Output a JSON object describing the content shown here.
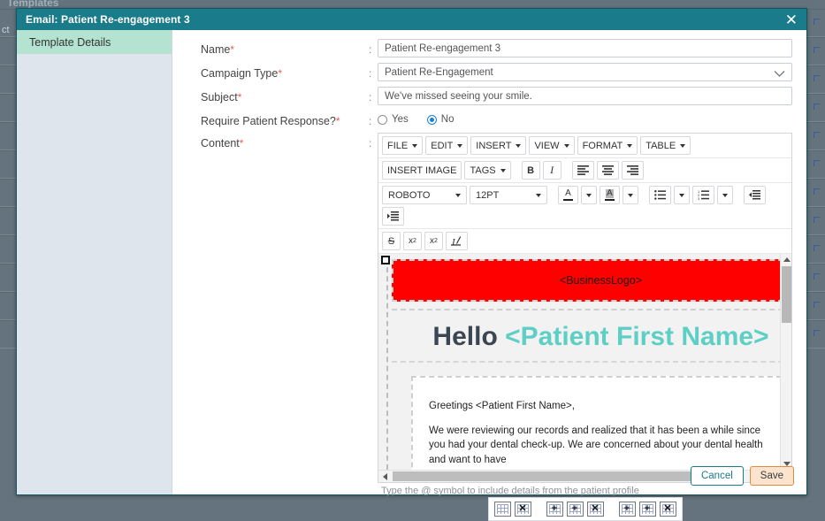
{
  "background": {
    "page_heading": "Templates",
    "column_label": "ct",
    "row_count": 12
  },
  "dialog": {
    "title": "Email: Patient Re-engagement 3",
    "close_icon": "close-icon"
  },
  "sidebar": {
    "items": [
      {
        "label": "Template Details",
        "active": true
      }
    ]
  },
  "form": {
    "colon": ":",
    "required_marker": "*",
    "fields": {
      "name": {
        "label": "Name",
        "value": "Patient Re-engagement 3",
        "required": true
      },
      "campaign_type": {
        "label": "Campaign Type",
        "value": "Patient Re-Engagement",
        "required": true,
        "chevron_icon": "chevron-down-icon"
      },
      "subject": {
        "label": "Subject",
        "value": "We've missed seeing your smile.",
        "required": true
      },
      "require_response": {
        "label": "Require Patient Response?",
        "required": true,
        "options": [
          {
            "label": "Yes",
            "selected": false
          },
          {
            "label": "No",
            "selected": true
          }
        ]
      },
      "content": {
        "label": "Content",
        "required": true
      }
    }
  },
  "editor": {
    "menubar": [
      {
        "label": "FILE"
      },
      {
        "label": "EDIT"
      },
      {
        "label": "INSERT"
      },
      {
        "label": "VIEW"
      },
      {
        "label": "FORMAT"
      },
      {
        "label": "TABLE"
      }
    ],
    "row2": {
      "insert_image": "INSERT IMAGE",
      "tags": "TAGS",
      "bold": "B",
      "italic": "I",
      "align_left_icon": "align-left-icon",
      "align_center_icon": "align-center-icon",
      "align_right_icon": "align-right-icon"
    },
    "row3": {
      "font_family": "ROBOTO",
      "font_size": "12PT",
      "text_color_icon": "text-color-icon",
      "text_color_caret_icon": "chevron-down-icon",
      "highlight_color_icon": "highlight-color-icon",
      "highlight_caret_icon": "chevron-down-icon",
      "bullet_list_icon": "bullet-list-icon",
      "bullet_list_caret_icon": "chevron-down-icon",
      "numbered_list_icon": "numbered-list-icon",
      "numbered_list_caret_icon": "chevron-down-icon",
      "decrease_indent_icon": "decrease-indent-icon",
      "increase_indent_icon": "increase-indent-icon"
    },
    "row4": {
      "strikethrough": "S",
      "superscript": "x",
      "superscript_sup": "2",
      "subscript": "x",
      "subscript_sub": "2",
      "clear_format_icon": "clear-formatting-icon"
    },
    "content": {
      "logo_placeholder": "<BusinessLogo>",
      "logo_color": "#fe0000",
      "heading_prefix": "Hello",
      "heading_token": "<Patient First Name>",
      "heading_token_color": "#5ecfc4",
      "paragraphs": [
        "Greetings <Patient First Name>,",
        "We were reviewing our records and realized that it has been a while since you had your dental check-up. We are concerned about your dental health and want to have"
      ]
    },
    "hint": "Type the @ symbol to include details from the patient profile",
    "scroll": {
      "up_icon": "scroll-up-arrow-icon",
      "down_icon": "scroll-down-arrow-icon",
      "left_icon": "scroll-left-arrow-icon",
      "right_icon": "scroll-right-arrow-icon"
    }
  },
  "table_tools": [
    {
      "name": "insert-table",
      "mark": ""
    },
    {
      "name": "delete-table",
      "mark": "✕"
    },
    {
      "name": "insert-row-before",
      "mark": "+"
    },
    {
      "name": "insert-row-after",
      "mark": "+"
    },
    {
      "name": "delete-row",
      "mark": "✕"
    },
    {
      "name": "insert-column-before",
      "mark": "+"
    },
    {
      "name": "insert-column-after",
      "mark": "+"
    },
    {
      "name": "delete-column",
      "mark": "✕"
    }
  ],
  "footer": {
    "cancel_label": "Cancel",
    "save_label": "Save",
    "cancel_color": "#1a7b8b",
    "save_bg": "#fbe3cd",
    "save_border": "#e08a3c"
  },
  "theme": {
    "titlebar": "#1a7b8b",
    "sidebar_active": "#b4e3d2",
    "sidebar_bg": "#dfe5ec",
    "backdrop": "#64737d",
    "required": "#e8604c",
    "radio_selected": "#1b7fd4"
  }
}
